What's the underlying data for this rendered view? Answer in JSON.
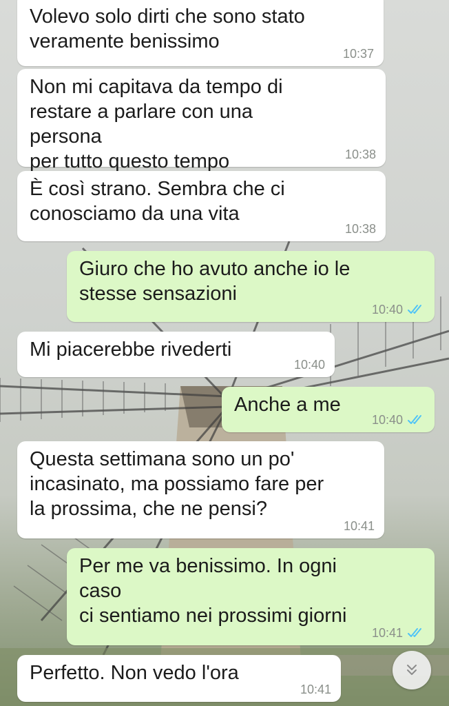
{
  "messages": [
    {
      "dir": "in",
      "text": "Volevo solo dirti che sono stato\nveramente benissimo",
      "time": "10:37"
    },
    {
      "dir": "in",
      "text": "Non mi capitava da tempo di\nrestare a parlare con una persona\nper tutto questo tempo",
      "time": "10:38"
    },
    {
      "dir": "in",
      "text": "È così strano. Sembra che ci\nconosciamo da una vita",
      "time": "10:38"
    },
    {
      "dir": "out",
      "text": "Giuro che ho avuto anche io le\nstesse sensazioni",
      "time": "10:40",
      "status": "read"
    },
    {
      "dir": "in",
      "text": "Mi piacerebbe rivederti",
      "time": "10:40"
    },
    {
      "dir": "out",
      "text": "Anche a me",
      "time": "10:40",
      "status": "read"
    },
    {
      "dir": "in",
      "text": "Questa settimana sono un po'\nincasinato, ma possiamo fare per\nla prossima, che ne pensi?",
      "time": "10:41"
    },
    {
      "dir": "out",
      "text": "Per me va benissimo. In ogni caso\nci sentiamo nei prossimi giorni",
      "time": "10:41",
      "status": "read"
    },
    {
      "dir": "in",
      "text": "Perfetto. Non vedo l'ora",
      "time": "10:41"
    }
  ],
  "scroll_button": {
    "icon": "double-chevron-down-icon"
  },
  "colors": {
    "incoming_bubble": "#ffffff",
    "outgoing_bubble": "#dcf8c6",
    "read_ticks": "#4fc3f7",
    "timestamp": "#8a8f8a"
  }
}
